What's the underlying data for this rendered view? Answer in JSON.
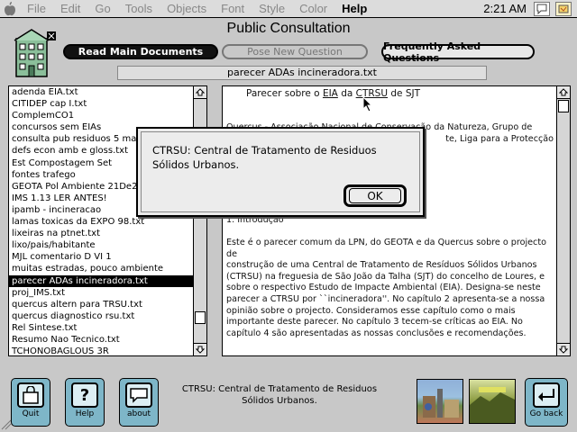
{
  "menubar": {
    "items": [
      "File",
      "Edit",
      "Go",
      "Tools",
      "Objects",
      "Font",
      "Style",
      "Color",
      "Help"
    ],
    "active_item": "Help",
    "clock": "2:21 AM"
  },
  "window": {
    "title": "Public Consultation",
    "buttons": {
      "read_docs": "Read Main Documents",
      "pose_question": "Pose New Question",
      "faq": "Frequently Asked Questions"
    },
    "current_file": "parecer ADAs incineradora.txt"
  },
  "file_list": {
    "items": [
      "adenda EIA.txt",
      "CITIDEP cap I.txt",
      "ComplemCO1",
      "concursos sem EIAs",
      "consulta pub residuos 5 mai",
      "defs econ amb e gloss.txt",
      "Est Compostagem Set",
      "fontes trafego",
      "GEOTA Pol Ambiente 21De29",
      "IMS 1.13 LER ANTES!",
      "ipamb - incineracao",
      "lamas toxicas da EXPO 98.txt",
      "lixeiras na ptnet.txt",
      "lixo/pais/habitante",
      "MJL comentario D VI 1",
      "muitas estradas, pouco ambiente",
      "parecer ADAs incineradora.txt",
      "proj_IMS.txt",
      "quercus altern para TRSU.txt",
      "quercus diagnostico rsu.txt",
      "Rel Sintese.txt",
      "Resumo Nao Tecnico.txt",
      "TCHONOBAGLOUS 3R"
    ],
    "selected_index": 16
  },
  "document": {
    "heading_pre": "Parecer sobre o ",
    "heading_eia": "EIA",
    "heading_mid": " da ",
    "heading_ctrsu": "CTRSU",
    "heading_post": " de SJT",
    "line1_left": "Quercus - Associação Nacional de Conservação da Natureza, Grupo de",
    "line2_right": "te, Liga para a Protecção",
    "section": "1. Introdução",
    "body": [
      "Este é o parecer comum da LPN, do GEOTA e da Quercus sobre o projecto de",
      "construção de uma Central de Tratamento de Resíduos Sólidos Urbanos",
      "(CTRSU) na freguesia de São João da Talha (SJT) do concelho de Loures, e",
      "sobre o respectivo Estudo de Impacte Ambiental (EIA). Designa-se neste",
      "parecer a CTRSU por ``incineradora''. No capítulo 2 apresenta-se a nossa",
      "opinião sobre o projecto. Consideramos esse capítulo como o mais",
      "importante deste parecer. No capítulo 3 tecem-se críticas ao EIA. No",
      "capítulo 4 são apresentadas as nossas conclusões e recomendações."
    ]
  },
  "dialog": {
    "message": "CTRSU: Central de Tratamento de Residuos Sólidos Urbanos.",
    "ok_label": "OK"
  },
  "bottom": {
    "quit_label": "Quit",
    "help_label": "Help",
    "about_label": "about",
    "go_back_label": "Go back",
    "status_text": "CTRSU: Central de Tratamento de Residuos Sólidos Urbanos."
  },
  "colors": {
    "accent_button": "#7eb6c8",
    "selection": "#000000"
  }
}
